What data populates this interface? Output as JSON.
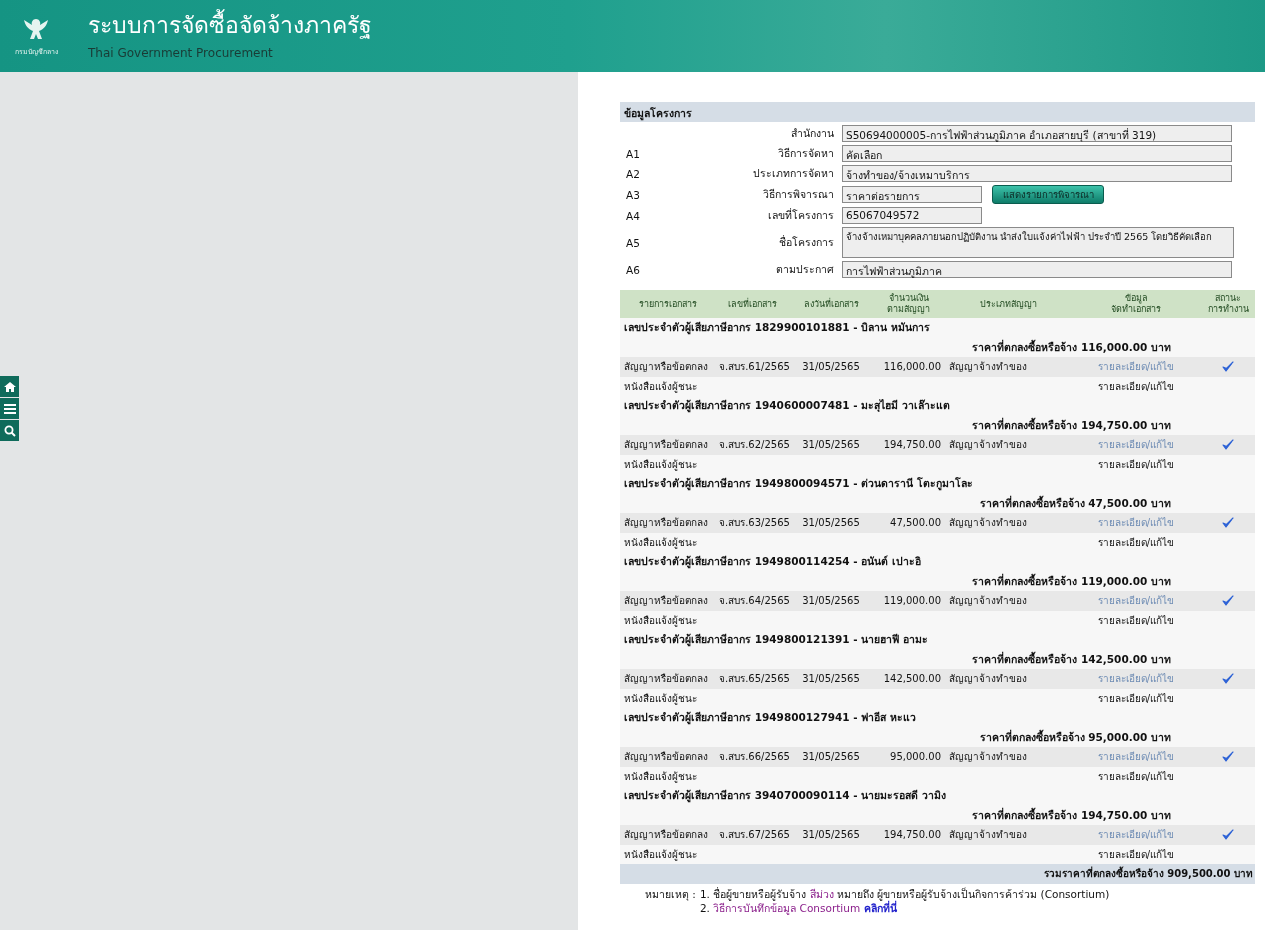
{
  "header": {
    "title": "ระบบการจัดซื้อจัดจ้างภาครัฐ",
    "subtitle": "Thai Government Procurement",
    "logo_caption": "กรมบัญชีกลาง"
  },
  "project": {
    "title": "ข้อมูลโครงการ",
    "fields": [
      {
        "label": "สำนักงาน",
        "value": "S50694000005-การไฟฟ้าส่วนภูมิภาค อำเภอสายบุรี (สาขาที่ 319)",
        "kind": "long"
      },
      {
        "code": "A1",
        "label": "วิธีการจัดหา",
        "value": "คัดเลือก",
        "kind": "long"
      },
      {
        "code": "A2",
        "label": "ประเภทการจัดหา",
        "value": "จ้างทำของ/จ้างเหมาบริการ",
        "kind": "long"
      },
      {
        "code": "A3",
        "label": "วิธีการพิจารณา",
        "value": "ราคาต่อรายการ",
        "kind": "short",
        "button": "แสดงรายการพิจารณา"
      },
      {
        "code": "A4",
        "label": "เลขที่โครงการ",
        "value": "65067049572",
        "kind": "short"
      },
      {
        "code": "A5",
        "label": "ชื่อโครงการ",
        "value": "จ้างจ้างเหมาบุคคลภายนอกปฏิบัติงาน นำส่งใบแจ้งค่าไฟฟ้า ประจำปี 2565 โดยวิธีคัดเลือก",
        "kind": "textarea"
      },
      {
        "code": "A6",
        "label": "ตามประกาศ",
        "value": "การไฟฟ้าส่วนภูมิภาค",
        "kind": "long"
      }
    ]
  },
  "table": {
    "columns": [
      [
        "รายการเอกสาร"
      ],
      [
        "เลขที่เอกสาร"
      ],
      [
        "ลงวันที่เอกสาร"
      ],
      [
        "จำนวนเงิน",
        "ตามสัญญา"
      ],
      [
        "ประเภทสัญญา"
      ],
      [
        "ข้อมูล",
        "จัดทำเอกสาร"
      ],
      [
        "สถานะ",
        "การทำงาน"
      ]
    ],
    "groups": [
      {
        "vendor": "เลขประจำตัวผู้เสียภาษีอากร 1829900101881 - บิลาน หมันการ",
        "price": "ราคาที่ตกลงซื้อหรือจ้าง 116,000.00 บาท",
        "documents": [
          {
            "name": "สัญญาหรือข้อตกลง",
            "number": "จ.สบร.61/2565",
            "date": "31/05/2565",
            "amount": "116,000.00",
            "type": "สัญญาจ้างทำของ",
            "action": "รายละเอียด/แก้ไข",
            "link": true,
            "done": true
          },
          {
            "name": "หนังสือแจ้งผู้ชนะ",
            "action": "รายละเอียด/แก้ไข",
            "link": false,
            "done": false
          }
        ]
      },
      {
        "vendor": "เลขประจำตัวผู้เสียภาษีอากร 1940600007481 - มะสุไฮมี วาเล๊าะแต",
        "price": "ราคาที่ตกลงซื้อหรือจ้าง 194,750.00 บาท",
        "documents": [
          {
            "name": "สัญญาหรือข้อตกลง",
            "number": "จ.สบร.62/2565",
            "date": "31/05/2565",
            "amount": "194,750.00",
            "type": "สัญญาจ้างทำของ",
            "action": "รายละเอียด/แก้ไข",
            "link": true,
            "done": true
          },
          {
            "name": "หนังสือแจ้งผู้ชนะ",
            "action": "รายละเอียด/แก้ไข",
            "link": false,
            "done": false
          }
        ]
      },
      {
        "vendor": "เลขประจำตัวผู้เสียภาษีอากร 1949800094571 - ต่วนดารานี โตะกูมาโละ",
        "price": "ราคาที่ตกลงซื้อหรือจ้าง 47,500.00 บาท",
        "documents": [
          {
            "name": "สัญญาหรือข้อตกลง",
            "number": "จ.สบร.63/2565",
            "date": "31/05/2565",
            "amount": "47,500.00",
            "type": "สัญญาจ้างทำของ",
            "action": "รายละเอียด/แก้ไข",
            "link": true,
            "done": true
          },
          {
            "name": "หนังสือแจ้งผู้ชนะ",
            "action": "รายละเอียด/แก้ไข",
            "link": false,
            "done": false
          }
        ]
      },
      {
        "vendor": "เลขประจำตัวผู้เสียภาษีอากร 1949800114254 - อนันต์ เปาะอิ",
        "price": "ราคาที่ตกลงซื้อหรือจ้าง 119,000.00 บาท",
        "documents": [
          {
            "name": "สัญญาหรือข้อตกลง",
            "number": "จ.สบร.64/2565",
            "date": "31/05/2565",
            "amount": "119,000.00",
            "type": "สัญญาจ้างทำของ",
            "action": "รายละเอียด/แก้ไข",
            "link": true,
            "done": true
          },
          {
            "name": "หนังสือแจ้งผู้ชนะ",
            "action": "รายละเอียด/แก้ไข",
            "link": false,
            "done": false
          }
        ]
      },
      {
        "vendor": "เลขประจำตัวผู้เสียภาษีอากร 1949800121391 - นายฮาฟี อามะ",
        "price": "ราคาที่ตกลงซื้อหรือจ้าง 142,500.00 บาท",
        "documents": [
          {
            "name": "สัญญาหรือข้อตกลง",
            "number": "จ.สบร.65/2565",
            "date": "31/05/2565",
            "amount": "142,500.00",
            "type": "สัญญาจ้างทำของ",
            "action": "รายละเอียด/แก้ไข",
            "link": true,
            "done": true
          },
          {
            "name": "หนังสือแจ้งผู้ชนะ",
            "action": "รายละเอียด/แก้ไข",
            "link": false,
            "done": false
          }
        ]
      },
      {
        "vendor": "เลขประจำตัวผู้เสียภาษีอากร 1949800127941 - ฟาอีส หะแว",
        "price": "ราคาที่ตกลงซื้อหรือจ้าง 95,000.00 บาท",
        "documents": [
          {
            "name": "สัญญาหรือข้อตกลง",
            "number": "จ.สบร.66/2565",
            "date": "31/05/2565",
            "amount": "95,000.00",
            "type": "สัญญาจ้างทำของ",
            "action": "รายละเอียด/แก้ไข",
            "link": true,
            "done": true
          },
          {
            "name": "หนังสือแจ้งผู้ชนะ",
            "action": "รายละเอียด/แก้ไข",
            "link": false,
            "done": false
          }
        ]
      },
      {
        "vendor": "เลขประจำตัวผู้เสียภาษีอากร 3940700090114 - นายมะรอสดี วามิง",
        "price": "ราคาที่ตกลงซื้อหรือจ้าง 194,750.00 บาท",
        "documents": [
          {
            "name": "สัญญาหรือข้อตกลง",
            "number": "จ.สบร.67/2565",
            "date": "31/05/2565",
            "amount": "194,750.00",
            "type": "สัญญาจ้างทำของ",
            "action": "รายละเอียด/แก้ไข",
            "link": true,
            "done": true
          },
          {
            "name": "หนังสือแจ้งผู้ชนะ",
            "action": "รายละเอียด/แก้ไข",
            "link": false,
            "done": false
          }
        ]
      }
    ],
    "total": "รวมราคาที่ตกลงซื้อหรือจ้าง 909,500.00 บาท"
  },
  "notes": {
    "label": "หมายเหตุ :",
    "items": [
      [
        {
          "text": "1. ชื่อผู้ขายหรือผู้รับจ้าง ",
          "kind": "plain"
        },
        {
          "text": "สีม่วง",
          "kind": "purple"
        },
        {
          "text": " หมายถึง ผู้ขายหรือผู้รับจ้างเป็นกิจการค้าร่วม (Consortium)",
          "kind": "plain"
        }
      ],
      [
        {
          "text": "2. ",
          "kind": "plain"
        },
        {
          "text": "วิธีการบันทึกข้อมูล Consortium",
          "kind": "purple"
        },
        {
          "text": "คลิกที่นี่",
          "kind": "link"
        }
      ]
    ]
  }
}
